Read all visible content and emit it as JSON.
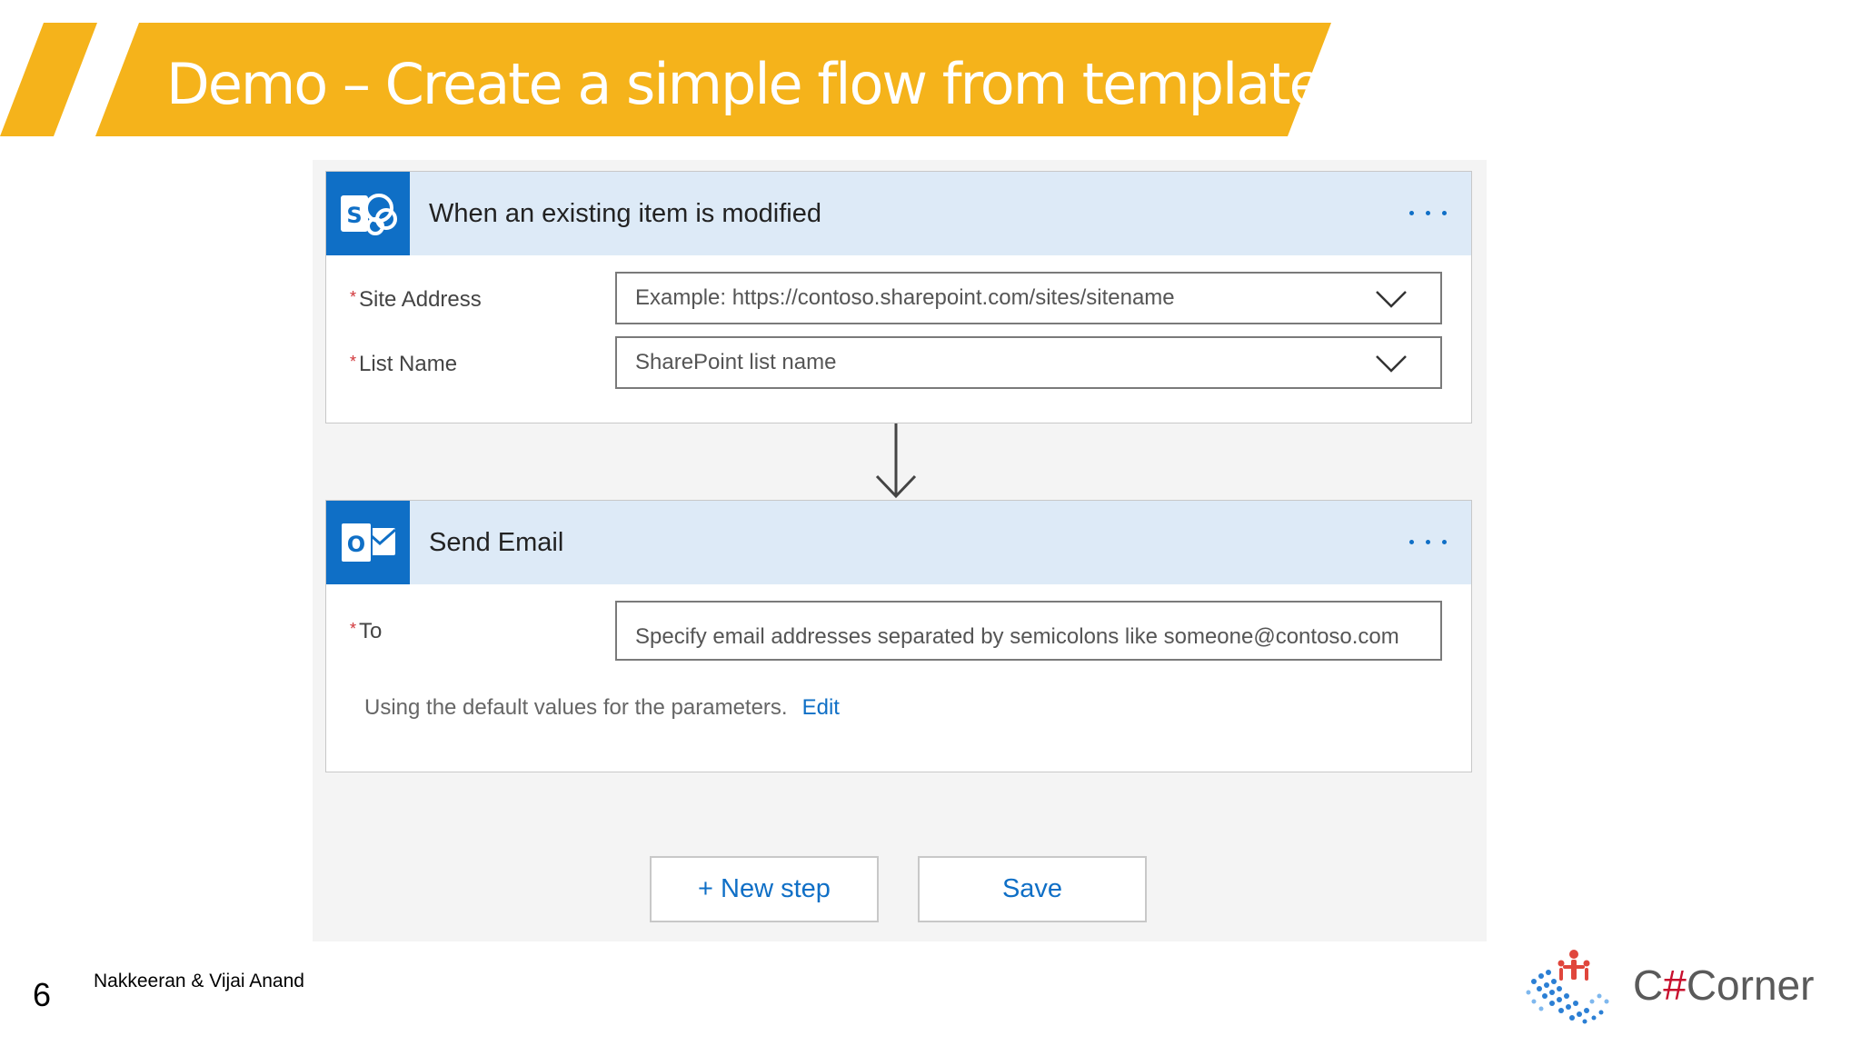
{
  "slide": {
    "title": "Demo – Create a simple flow from template",
    "page_number": "6",
    "author": "Nakkeeran & Vijai Anand",
    "logo": {
      "prefix": "C",
      "hash": "#",
      "suffix": "Corner"
    },
    "banner_color": "#f5b31b"
  },
  "flow": {
    "trigger": {
      "icon": "sharepoint-icon",
      "title": "When an existing item is modified",
      "fields": [
        {
          "label": "Site Address",
          "required": "*",
          "placeholder": "Example: https://contoso.sharepoint.com/sites/sitename"
        },
        {
          "label": "List Name",
          "required": "*",
          "placeholder": "SharePoint list name"
        }
      ]
    },
    "action": {
      "icon": "outlook-icon",
      "title": "Send Email",
      "fields": [
        {
          "label": "To",
          "required": "*",
          "placeholder": "Specify email addresses separated by semicolons like someone@contoso.com"
        }
      ],
      "info": "Using the default values for the parameters.",
      "edit_label": "Edit"
    },
    "buttons": {
      "new_step": "+ New step",
      "save": "Save"
    },
    "accent_color": "#0f6fc6",
    "header_color": "#ddeaf7"
  }
}
